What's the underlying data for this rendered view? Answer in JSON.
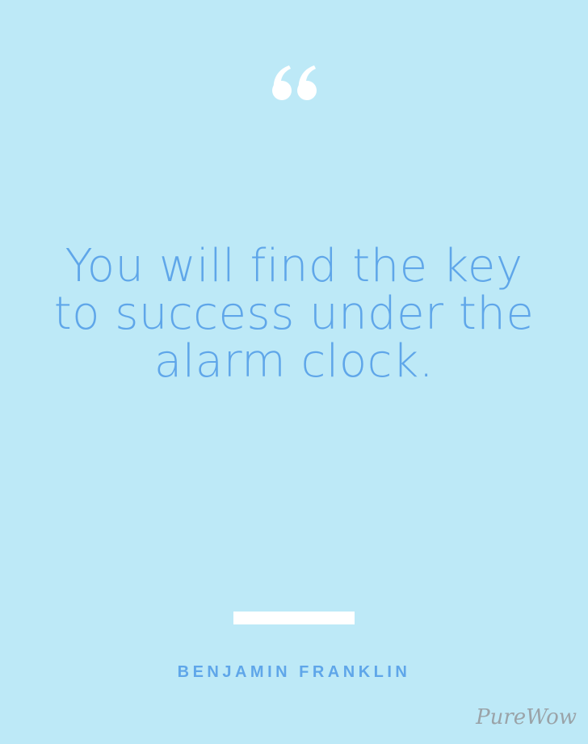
{
  "quote": {
    "text": "You will find the key to success under the alarm clock."
  },
  "author": "BENJAMIN FRANKLIN",
  "brand": "PureWow",
  "icons": {
    "quote_mark": "open-quote-icon"
  },
  "colors": {
    "background": "#bde9f7",
    "text": "#5fa6e9",
    "accent": "#ffffff",
    "logo": "#9aa3a8"
  }
}
